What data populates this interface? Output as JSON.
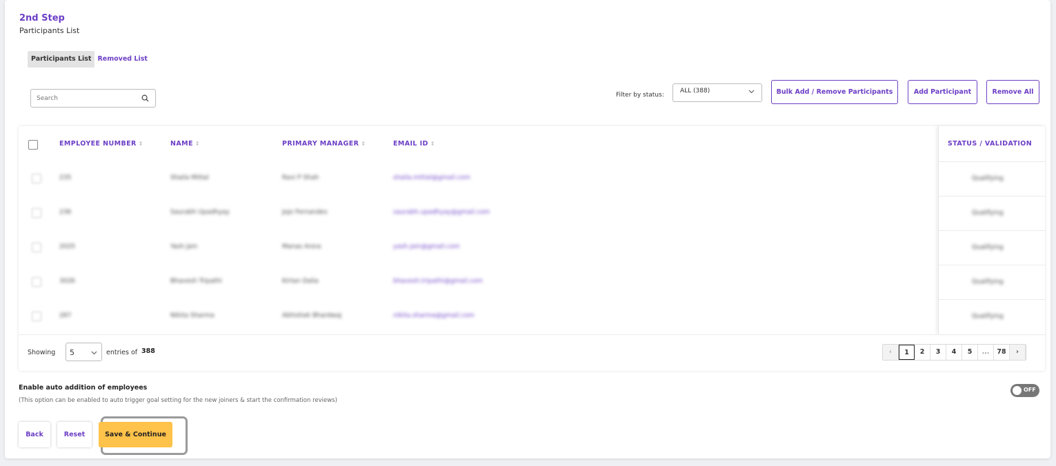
{
  "step": {
    "title": "2nd Step",
    "subtitle": "Participants List"
  },
  "tabs": [
    {
      "label": "Participants List",
      "active": true
    },
    {
      "label": "Removed List",
      "active": false
    }
  ],
  "search": {
    "placeholder": "Search",
    "value": ""
  },
  "filter": {
    "label": "Filter by status:",
    "selected": "ALL (388)"
  },
  "actions": {
    "bulk": "Bulk Add / Remove Participants",
    "add": "Add Participant",
    "remove_all": "Remove All"
  },
  "table": {
    "columns": [
      "EMPLOYEE NUMBER",
      "NAME",
      "PRIMARY MANAGER",
      "EMAIL ID",
      "STATUS / VALIDATION"
    ],
    "sort_glyph": "⇕",
    "rows": [
      {
        "emp": "235",
        "name": "Shaila Mittal",
        "manager": "Ravi P Shah",
        "email": "shaila.mittal@gmail.com",
        "status": "Qualifying"
      },
      {
        "emp": "236",
        "name": "Saurabh Upadhyay",
        "manager": "Jojo Fernandes",
        "email": "saurabh.upadhyay@gmail.com",
        "status": "Qualifying"
      },
      {
        "emp": "2025",
        "name": "Yash Jain",
        "manager": "Manas Arora",
        "email": "yash.jain@gmail.com",
        "status": "Qualifying"
      },
      {
        "emp": "3026",
        "name": "Bhavesh Tripathi",
        "manager": "Kirtan Dalia",
        "email": "bhavesh.tripathi@gmail.com",
        "status": "Qualifying"
      },
      {
        "emp": "287",
        "name": "Nikita Sharma",
        "manager": "Abhishek Bhardwaj",
        "email": "nikita.sharma@gmail.com",
        "status": "Qualifying"
      }
    ]
  },
  "pagination": {
    "showing_label": "Showing",
    "per_page": "5",
    "entries_of_label": "entries of",
    "total": "388",
    "prev_glyph": "‹",
    "next_glyph": "›",
    "pages": [
      "1",
      "2",
      "3",
      "4",
      "5",
      "...",
      "78"
    ],
    "current_page": "1"
  },
  "auto_addition": {
    "title": "Enable auto addition of employees",
    "description": "(This option can be enabled to auto trigger goal setting for the new joiners & start the confirmation reviews)",
    "toggle_label": "OFF",
    "enabled": false
  },
  "footer": {
    "back": "Back",
    "reset": "Reset",
    "save": "Save & Continue"
  },
  "colors": {
    "accent": "#6c3fc6",
    "primary_button": "#ffc24a"
  }
}
